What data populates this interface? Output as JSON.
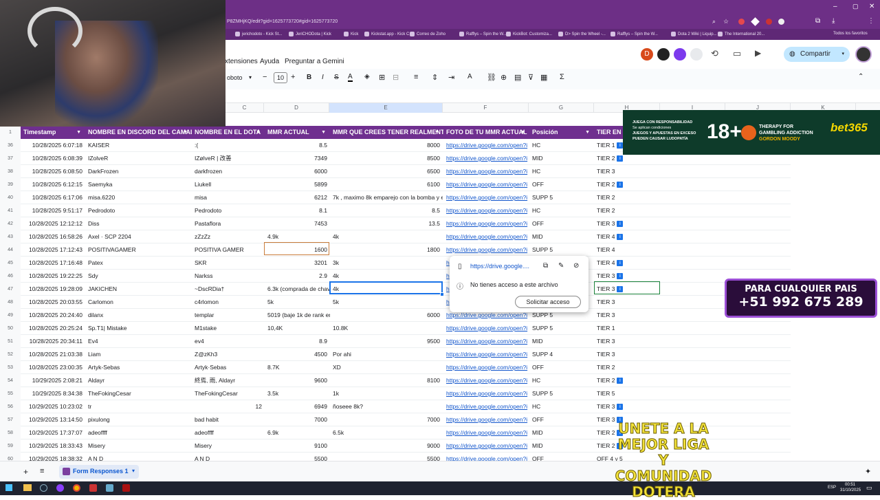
{
  "browser": {
    "url": "P8ZMHjKQ/edit?gid=1625773720#gid=1625773720",
    "bookmarks": [
      "jerichodoto - Kick St...",
      "JeriCHODota | Kick",
      "Kick",
      "Kickstat.app - Kick C...",
      "Correo de Zoho",
      "Rafflys – Spin the W...",
      "KickBot: Customiza...",
      "D> Spin the Wheel -...",
      "Rafflys – Spin the W...",
      "Dota 2 Wiki | Liquip...",
      "The International 20..."
    ],
    "all_favorites": "Todos los favoritos"
  },
  "app": {
    "menu": [
      "xtensiones",
      "Ayuda",
      "Preguntar a Gemini"
    ],
    "avatar_letter": "D",
    "share_label": "Compartir",
    "font_name": "oboto",
    "font_size": "10"
  },
  "columns": [
    "C",
    "D",
    "E",
    "F",
    "G",
    "H",
    "I",
    "J",
    "K"
  ],
  "header_row_number": "1",
  "headers": [
    "Timestamp",
    "NOMBRE EN DISCORD DEL CAMAL",
    "NOMBRE EN EL DOTA",
    "MMR ACTUAL",
    "MMR QUE CREES TENER REALMENTE",
    "FOTO DE TU MMR ACTUAL",
    "Posición",
    "TIER EN E"
  ],
  "rows": [
    {
      "n": "36",
      "ts": "10/28/2025 6:07:18",
      "discord": "KAISER",
      "dota": ":(",
      "mmr": "8.5",
      "mmr_real": "8000",
      "foto": "https://drive.google.com/open?i",
      "pos": "HC",
      "tier": "TIER 1",
      "info": true
    },
    {
      "n": "37",
      "ts": "10/28/2025 6:08:39",
      "discord": "IZolveR",
      "dota": "IZølveR | 改善",
      "mmr": "7349",
      "mmr_real": "8500",
      "foto": "https://drive.google.com/open?i",
      "pos": "MID",
      "tier": "TIER 2",
      "info": true
    },
    {
      "n": "38",
      "ts": "10/28/2025 6:08:50",
      "discord": "DarkFrozen",
      "dota": "darkfrozen",
      "mmr": "6000",
      "mmr_real": "6500",
      "foto": "https://drive.google.com/open?i",
      "pos": "HC",
      "tier": "TIER 3",
      "info": false
    },
    {
      "n": "39",
      "ts": "10/28/2025 6:12:15",
      "discord": "Saemyka",
      "dota": "Liukell",
      "mmr": "5899",
      "mmr_real": "6100",
      "foto": "https://drive.google.com/open?i",
      "pos": "OFF",
      "tier": "TIER 2",
      "info": true
    },
    {
      "n": "40",
      "ts": "10/28/2025 6:17:06",
      "discord": "misa.6220",
      "dota": "misa",
      "mmr": "6212",
      "mmr_real": "7k , maximo 8k  emparejo con la bomba y e",
      "foto": "https://drive.google.com/open?i",
      "pos": "SUPP 5",
      "tier": "TIER 2",
      "info": false,
      "real_left": true
    },
    {
      "n": "41",
      "ts": "10/28/2025 9:51:17",
      "discord": "Pedrodoto",
      "dota": "Pedrodoto",
      "mmr": "8.1",
      "mmr_real": "8.5",
      "foto": "https://drive.google.com/open?i",
      "pos": "HC",
      "tier": "TIER 2",
      "info": false
    },
    {
      "n": "42",
      "ts": "10/28/2025 12:12:12",
      "discord": "Diss",
      "dota": "Pastaflora",
      "mmr": "7453",
      "mmr_real": "13.5",
      "foto": "https://drive.google.com/open?i",
      "pos": "OFF",
      "tier": "TIER 3",
      "info": true
    },
    {
      "n": "43",
      "ts": "10/28/2025 16:58:26",
      "discord": "Axel · SCP 2204",
      "dota": "zZzZz",
      "mmr": "4.9k",
      "mmr_real": "4k",
      "foto": "https://drive.google.com/open?i",
      "pos": "MID",
      "tier": "TIER 4",
      "info": true,
      "mmr_left": true,
      "real_left": true
    },
    {
      "n": "44",
      "ts": "10/28/2025 17:12:43",
      "discord": "POSITIVAGAMER",
      "dota": "POSITIVA GAMER",
      "mmr": "1600",
      "mmr_real": "1800",
      "foto": "https://drive.google.com/open?i",
      "pos": "SUPP 5",
      "tier": "TIER 4",
      "info": false
    },
    {
      "n": "45",
      "ts": "10/28/2025 17:16:48",
      "discord": "Patex",
      "dota": "SKR",
      "mmr": "3201",
      "mmr_real": "3k",
      "foto": "h",
      "pos": "",
      "tier": "TIER 4",
      "info": true,
      "real_left": true
    },
    {
      "n": "46",
      "ts": "10/28/2025 19:22:25",
      "discord": "Sdy",
      "dota": "Narkss",
      "mmr": "2.9",
      "mmr_real": "4k",
      "foto": "h",
      "pos": "",
      "tier": "TIER 3",
      "info": true,
      "real_left": true
    },
    {
      "n": "47",
      "ts": "10/28/2025 19:28:09",
      "discord": "JAKICHEN",
      "dota": "~DscRDia†",
      "mmr": "6.3k (comprada de chav",
      "mmr_real": "4k",
      "foto": "h",
      "pos": "",
      "tier": "TIER 3",
      "info": true,
      "mmr_left": true,
      "real_left": true
    },
    {
      "n": "48",
      "ts": "10/28/2025 20:03:55",
      "discord": "Carlomon",
      "dota": "c4rlomon",
      "mmr": "5k",
      "mmr_real": "5k",
      "foto": "h",
      "pos": "",
      "tier": "TIER 3",
      "info": false,
      "mmr_left": true,
      "real_left": true
    },
    {
      "n": "49",
      "ts": "10/28/2025 20:24:40",
      "discord": "dilanx",
      "dota": "templar",
      "mmr": "5019 (baje 1k de rank en",
      "mmr_real": "6000",
      "foto": "https://drive.google.com/open?i",
      "pos": "SUPP 5",
      "tier": "TIER 3",
      "info": false,
      "mmr_left": true
    },
    {
      "n": "50",
      "ts": "10/28/2025 20:25:24",
      "discord": "Sp.T1| Mistake",
      "dota": "M1stake",
      "mmr": "10,4K",
      "mmr_real": "10.8K",
      "foto": "https://drive.google.com/open?i",
      "pos": "SUPP 5",
      "tier": "TIER 1",
      "info": false,
      "mmr_left": true,
      "real_left": true
    },
    {
      "n": "51",
      "ts": "10/28/2025 20:34:11",
      "discord": "Ev4",
      "dota": "ev4",
      "mmr": "8.9",
      "mmr_real": "9500",
      "foto": "https://drive.google.com/open?i",
      "pos": "MID",
      "tier": "TIER 3",
      "info": false
    },
    {
      "n": "52",
      "ts": "10/28/2025 21:03:38",
      "discord": "Liam",
      "dota": "Z@zKh3",
      "mmr": "4500",
      "mmr_real": "Por ahi",
      "foto": "https://drive.google.com/open?i",
      "pos": "SUPP 4",
      "tier": "TIER 3",
      "info": false,
      "real_left": true
    },
    {
      "n": "53",
      "ts": "10/28/2025 23:00:35",
      "discord": "Artyk-Sebas",
      "dota": "Artyk·Sebas",
      "mmr": "8.7K",
      "mmr_real": "XD",
      "foto": "https://drive.google.com/open?i",
      "pos": "OFF",
      "tier": "TIER 2",
      "info": false,
      "mmr_left": true,
      "real_left": true
    },
    {
      "n": "54",
      "ts": "10/29/2025 2:08:21",
      "discord": "Aldayr",
      "dota": "終焉, 雨, Aldayr",
      "mmr": "9600",
      "mmr_real": "8100",
      "foto": "https://drive.google.com/open?i",
      "pos": "HC",
      "tier": "TIER 2",
      "info": true
    },
    {
      "n": "55",
      "ts": "10/29/2025 8:34:38",
      "discord": "TheFokingCesar",
      "dota": "TheFokingCesar",
      "mmr": "3.5k",
      "mmr_real": "1k",
      "foto": "https://drive.google.com/open?i",
      "pos": "SUPP 5",
      "tier": "TIER 5",
      "info": false,
      "mmr_left": true,
      "real_left": true
    },
    {
      "n": "56",
      "ts": "10/29/2025 10:23:02",
      "discord": "tr",
      "dota": "12",
      "mmr": "6949",
      "mmr_real": "ñoseee 8k?",
      "foto": "https://drive.google.com/open?i",
      "pos": "HC",
      "tier": "TIER 3",
      "info": true,
      "real_left": true,
      "dota_right": true
    },
    {
      "n": "57",
      "ts": "10/29/2025 13:14:50",
      "discord": "pixulong",
      "dota": "bad habit",
      "mmr": "7000",
      "mmr_real": "7000",
      "foto": "https://drive.google.com/open?i",
      "pos": "OFF",
      "tier": "TIER 3",
      "info": true
    },
    {
      "n": "58",
      "ts": "10/29/2025 17:37:07",
      "discord": "adeoffff",
      "dota": "adeoffff",
      "mmr": "6.9k",
      "mmr_real": "6.5k",
      "foto": "https://drive.google.com/open?i",
      "pos": "MID",
      "tier": "TIER 2",
      "info": true,
      "mmr_left": true,
      "real_left": true
    },
    {
      "n": "59",
      "ts": "10/29/2025 18:33:43",
      "discord": "Misery",
      "dota": "Misery",
      "mmr": "9100",
      "mmr_real": "9000",
      "foto": "https://drive.google.com/open?i",
      "pos": "MID",
      "tier": "TIER 2",
      "info": true
    },
    {
      "n": "60",
      "ts": "10/29/2025 18:38:32",
      "discord": "A N D",
      "dota": "A N D",
      "mmr": "5500",
      "mmr_real": "5500",
      "foto": "https://drive.google.com/open?i",
      "pos": "OFF",
      "tier": "OFF 4 y 5",
      "info": false
    }
  ],
  "popup": {
    "link": "https://drive.google....",
    "message": "No tienes acceso a este archivo",
    "button": "Solicitar acceso"
  },
  "sheet_tab": "Form Responses 1",
  "ads": {
    "gamble_line1": "JUEGA CON RESPONSABILIDAD",
    "gamble_line2": "Se aplican condiciones",
    "gamble_line3": "JUEGOS Y APUESTAS EN EXCESO",
    "gamble_line4": "PUEDEN CAUSAR LUDOPATÍA",
    "age": "18+",
    "therapy": "THERAPY FOR",
    "therapy2": "GAMBLING ADDICTION",
    "gordon": "GORDON MOODY",
    "brand": "bet365",
    "phone_title": "PARA CUALQUIER PAIS",
    "phone": "+51 992 675 289"
  },
  "watermark": [
    "UNETE A LA",
    "MEJOR LIGA",
    "Y COMUNIDAD",
    "DOTERA"
  ],
  "taskbar": {
    "time": "00:51",
    "date": "31/10/2025",
    "lang": "ESP"
  },
  "colors": {
    "header_purple": "#6f2f8f",
    "link": "#1155cc",
    "info_badge": "#1a73e8",
    "selection": "#1a73e8",
    "accent_orange": "#c97c3a"
  }
}
